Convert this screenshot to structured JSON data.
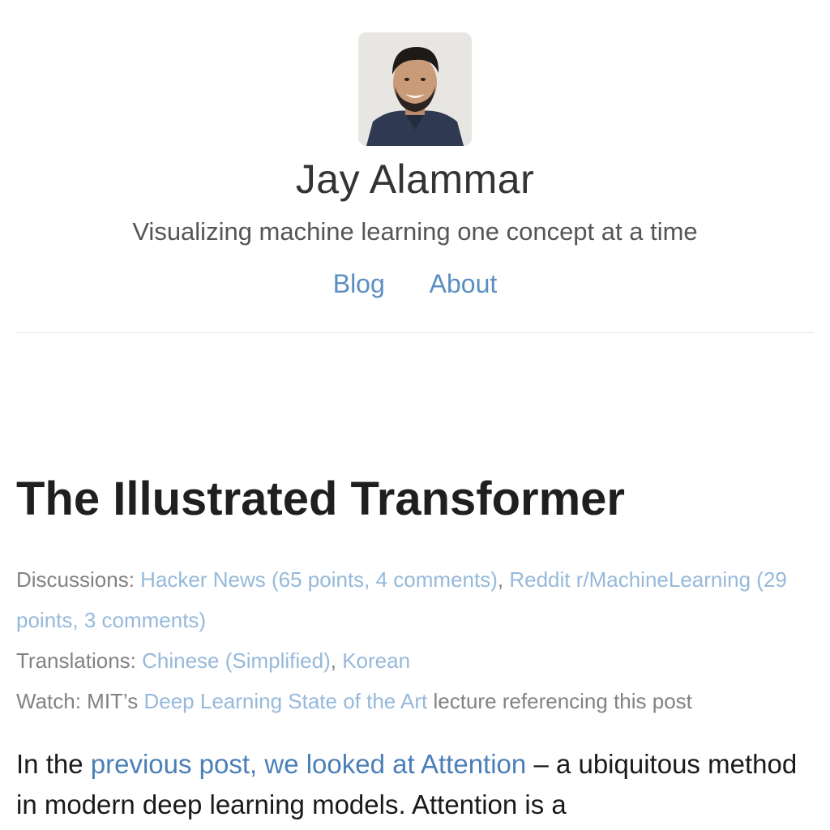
{
  "header": {
    "author_name": "Jay Alammar",
    "tagline": "Visualizing machine learning one concept at a time",
    "nav": [
      {
        "label": "Blog"
      },
      {
        "label": "About"
      }
    ]
  },
  "post": {
    "title": "The Illustrated Transformer",
    "discussions": {
      "label": "Discussions:",
      "links": [
        {
          "text": "Hacker News (65 points, 4 comments)"
        },
        {
          "text": "Reddit r/MachineLearning (29 points, 3 comments)"
        }
      ],
      "separator": ", "
    },
    "translations": {
      "label": "Translations:",
      "links": [
        {
          "text": "Chinese (Simplified)"
        },
        {
          "text": "Korean"
        }
      ],
      "separator": ", "
    },
    "watch": {
      "label": "Watch: MIT’s",
      "link_text": "Deep Learning State of the Art",
      "suffix": "lecture referencing this post"
    },
    "intro": {
      "prefix": "In the",
      "link_text": "previous post, we looked at Attention",
      "suffix": "– a ubiquitous method in modern deep learning models. Attention is a"
    }
  },
  "colors": {
    "link": "#5b8ec2",
    "meta_link": "#96b9db",
    "meta_text": "#828282",
    "title_text": "#1f1f1f"
  }
}
